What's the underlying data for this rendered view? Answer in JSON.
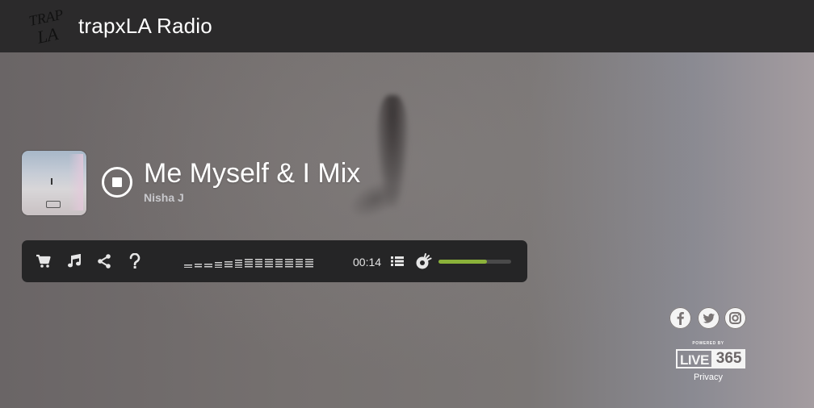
{
  "header": {
    "logo_text": "TRAP LA",
    "station_title": "trapxLA Radio"
  },
  "now_playing": {
    "title": "Me Myself & I Mix",
    "artist": "Nisha J"
  },
  "player": {
    "elapsed": "00:14",
    "volume_level": 0.67,
    "equalizer_levels": [
      0.35,
      0.45,
      0.4,
      0.55,
      0.7,
      0.85,
      0.9,
      0.9,
      0.9,
      0.9,
      0.9,
      0.9,
      0.9
    ],
    "icons": [
      "cart-icon",
      "music-note-icon",
      "share-icon",
      "help-icon",
      "playlist-icon",
      "volume-icon"
    ]
  },
  "footer": {
    "powered_by": "POWERED BY",
    "brand_live": "LIVE",
    "brand_num": "365",
    "privacy": "Privacy",
    "social": [
      "facebook-icon",
      "twitter-icon",
      "instagram-icon"
    ]
  },
  "colors": {
    "header_bg": "#2b2a2b",
    "controls_bg": "#252526",
    "volume_fill": "#8bb23a"
  }
}
